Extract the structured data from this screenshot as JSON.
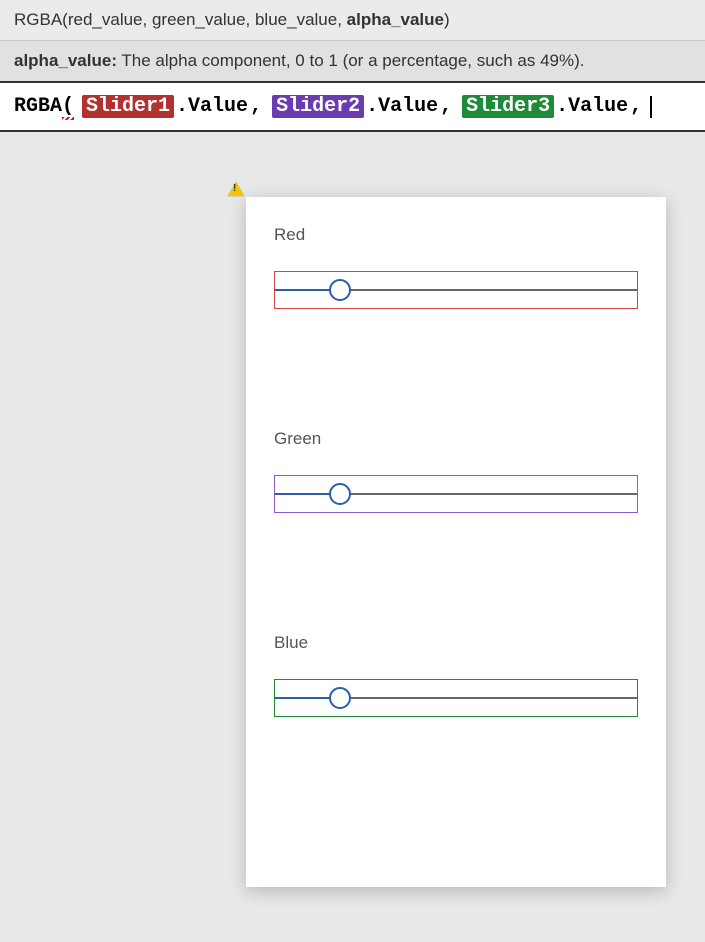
{
  "tooltip": {
    "signature_prefix": "RGBA(red_value, green_value, blue_value, ",
    "signature_bold": "alpha_value",
    "signature_suffix": ")",
    "param_name": "alpha_value:",
    "param_desc": " The alpha component, 0 to 1 (or a percentage, such as 49%)."
  },
  "formula": {
    "fn": "RGBA",
    "open": "(",
    "args": [
      {
        "ctrl": "Slider1",
        "color": "red",
        "prop": ".Value"
      },
      {
        "ctrl": "Slider2",
        "color": "purple",
        "prop": ".Value"
      },
      {
        "ctrl": "Slider3",
        "color": "green",
        "prop": ".Value"
      }
    ],
    "trailing_comma": ","
  },
  "sliders": [
    {
      "label": "Red",
      "border": "red",
      "value_percent": 18
    },
    {
      "label": "Green",
      "border": "purple",
      "value_percent": 18
    },
    {
      "label": "Blue",
      "border": "green",
      "value_percent": 18
    }
  ],
  "colors": {
    "slider1_bg": "#b23131",
    "slider2_bg": "#6b3bb0",
    "slider3_bg": "#1f8a3a",
    "track_fill": "#2b5ea8",
    "track_rest": "#666666"
  }
}
